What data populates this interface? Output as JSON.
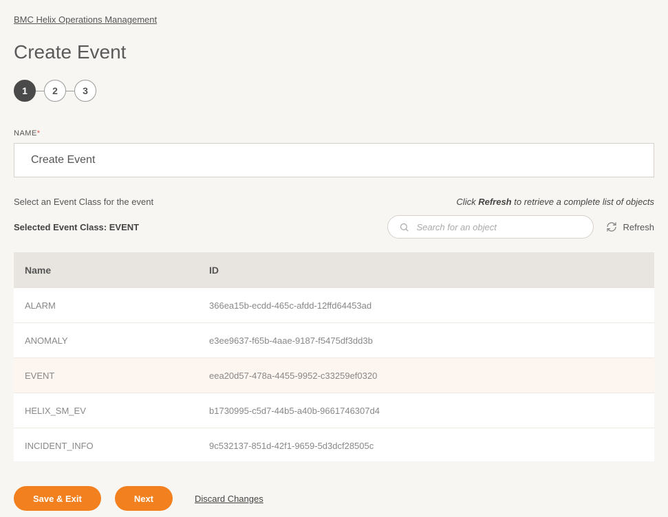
{
  "breadcrumb": "BMC Helix Operations Management",
  "page_title": "Create Event",
  "stepper": {
    "steps": [
      "1",
      "2",
      "3"
    ],
    "active_index": 0
  },
  "name_field": {
    "label": "NAME",
    "required": "*",
    "value": "Create Event"
  },
  "instruction": "Select an Event Class for the event",
  "refresh_hint_pre": "Click ",
  "refresh_hint_bold": "Refresh",
  "refresh_hint_post": " to retrieve a complete list of objects",
  "selected_class_label": "Selected Event Class: ",
  "selected_class_value": "EVENT",
  "search": {
    "placeholder": "Search for an object"
  },
  "refresh_label": "Refresh",
  "table": {
    "headers": {
      "name": "Name",
      "id": "ID"
    },
    "rows": [
      {
        "name": "ALARM",
        "id": "366ea15b-ecdd-465c-afdd-12ffd64453ad",
        "selected": false
      },
      {
        "name": "ANOMALY",
        "id": "e3ee9637-f65b-4aae-9187-f5475df3dd3b",
        "selected": false
      },
      {
        "name": "EVENT",
        "id": "eea20d57-478a-4455-9952-c33259ef0320",
        "selected": true
      },
      {
        "name": "HELIX_SM_EV",
        "id": "b1730995-c5d7-44b5-a40b-9661746307d4",
        "selected": false
      },
      {
        "name": "INCIDENT_INFO",
        "id": "9c532137-851d-42f1-9659-5d3dcf28505c",
        "selected": false
      }
    ]
  },
  "footer": {
    "save": "Save & Exit",
    "next": "Next",
    "discard": "Discard Changes"
  }
}
